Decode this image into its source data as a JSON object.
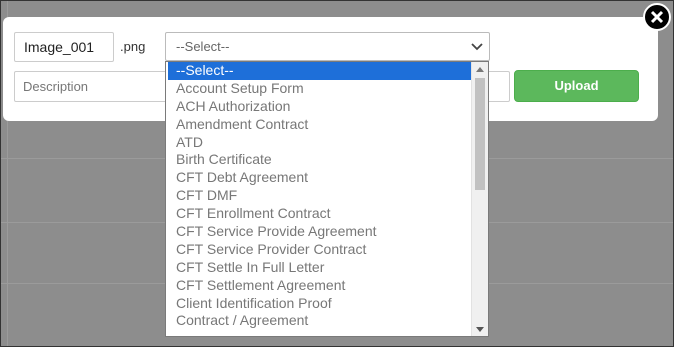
{
  "upload_form": {
    "filename_value": "Image_001",
    "extension": ".png",
    "document_type_selected": "--Select--",
    "description_placeholder": "Description",
    "upload_label": "Upload"
  },
  "dropdown": {
    "options": [
      "--Select--",
      "Account Setup Form",
      "ACH Authorization",
      "Amendment Contract",
      "ATD",
      "Birth Certificate",
      "CFT Debt Agreement",
      "CFT DMF",
      "CFT Enrollment Contract",
      "CFT Service Provide Agreement",
      "CFT Service Provider Contract",
      "CFT Settle In Full Letter",
      "CFT Settlement Agreement",
      "Client Identification Proof",
      "Contract / Agreement"
    ],
    "selected_index": 0
  },
  "colors": {
    "upload_button": "#5cb85c",
    "selected_option": "#1e6fd9",
    "overlay": "#8d8d8d"
  },
  "icons": {
    "close": "close-icon",
    "select_arrow": "chevron-down-icon"
  }
}
